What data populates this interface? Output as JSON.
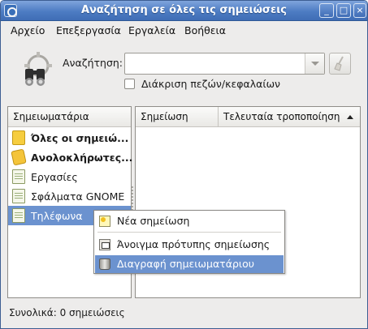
{
  "window": {
    "title": "Αναζήτηση σε όλες τις σημειώσεις",
    "controls": {
      "minimize": "_",
      "maximize": "□",
      "close": "×"
    }
  },
  "menubar": {
    "items": [
      {
        "label": "Αρχείο"
      },
      {
        "label": "Επεξεργασία"
      },
      {
        "label": "Εργαλεία"
      },
      {
        "label": "Βοήθεια"
      }
    ]
  },
  "search": {
    "label": "Αναζήτηση:",
    "value": "",
    "case_sensitive_label": "Διάκριση πεζών/κεφαλαίων",
    "case_sensitive_checked": false
  },
  "notebooks": {
    "header": "Σημειωματάρια",
    "items": [
      {
        "label": "Όλες οι σημειώ...",
        "icon": "folder-icon",
        "bold": true
      },
      {
        "label": "Ανολοκλήρωτες...",
        "icon": "folder-star-icon",
        "bold": true
      },
      {
        "label": "Εργασίες",
        "icon": "note-icon",
        "bold": false
      },
      {
        "label": "Σφάλματα GNOME",
        "icon": "note-icon",
        "bold": false
      },
      {
        "label": "Τηλέφωνα",
        "icon": "note-icon",
        "bold": false,
        "selected": true
      }
    ]
  },
  "notes_table": {
    "columns": [
      {
        "label": "Σημείωση"
      },
      {
        "label": "Τελευταία τροποποίηση",
        "sort": "ascending"
      }
    ],
    "rows": []
  },
  "context_menu": {
    "items": [
      {
        "label": "Νέα σημείωση",
        "icon": "new-note-icon"
      },
      {
        "label": "Άνοιγμα πρότυπης σημείωσης",
        "icon": "template-note-icon"
      },
      {
        "label": "Διαγραφή σημειωματάριου",
        "icon": "trash-icon",
        "highlighted": true
      }
    ]
  },
  "status": {
    "text": "Συνολικά: 0 σημειώσεις"
  },
  "colors": {
    "titlebar": "#4d7cc3",
    "selection": "#6b92cf",
    "window_bg": "#edeceb"
  }
}
